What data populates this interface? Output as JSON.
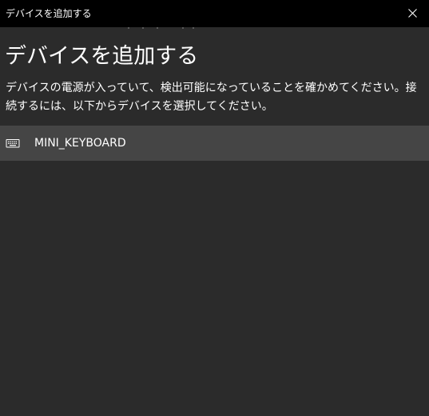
{
  "window": {
    "title": "デバイスを追加する",
    "close_icon": "close-icon"
  },
  "main": {
    "heading": "デバイスを追加する",
    "description": "デバイスの電源が入っていて、検出可能になっていることを確かめてください。接続するには、以下からデバイスを選択してください。",
    "devices": [
      {
        "label": "MINI_KEYBOARD",
        "icon": "keyboard-icon"
      }
    ]
  },
  "colors": {
    "titlebar": "#000000",
    "background": "#2b2b2b",
    "selected_item": "#454545",
    "text": "#ffffff"
  }
}
